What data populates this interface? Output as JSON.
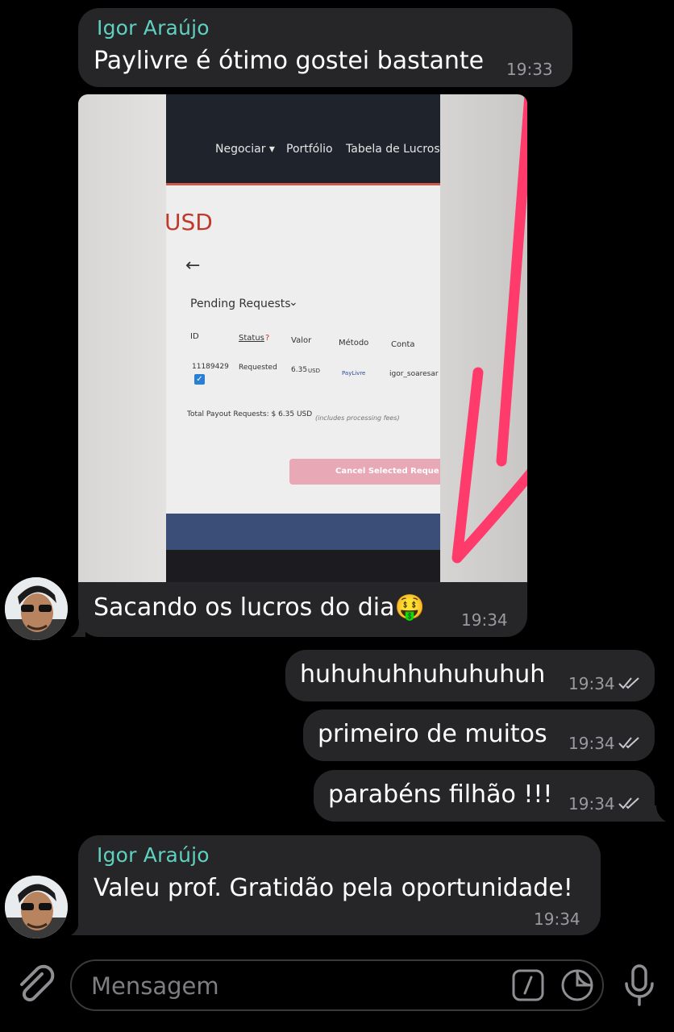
{
  "messages": [
    {
      "sender": "Igor Araújo",
      "text": "Paylivre é ótimo gostei bastante",
      "time": "19:33"
    },
    {
      "text": "Sacando os lucros do dia🤑",
      "time": "19:34",
      "screenshot": {
        "nav": [
          "Negociar ▾",
          "Portfólio",
          "Tabela de Lucros"
        ],
        "currency": "USD",
        "filter": "Pending Requests",
        "columns": [
          "ID",
          "Status",
          "?",
          "Valor",
          "Método",
          "Conta"
        ],
        "row": {
          "id": "11189429",
          "status": "Requested",
          "valor": "6.35",
          "valor_unit": "USD",
          "metodo": "PayLivre",
          "conta": "igor_soaresar"
        },
        "total": "Total Payout Requests: $ 6.35 USD",
        "total_note": "(includes processing fees)",
        "button": "Cancel Selected Reque"
      }
    },
    {
      "text": "huhuhuhhuhuhuhuh",
      "time": "19:34"
    },
    {
      "text": "primeiro de muitos",
      "time": "19:34"
    },
    {
      "text": "parabéns filhão !!!",
      "time": "19:34"
    },
    {
      "sender": "Igor Araújo",
      "text": "Valeu prof. Gratidão pela oportunidade!",
      "time": "19:34"
    }
  ],
  "composer": {
    "placeholder": "Mensagem"
  },
  "colors": {
    "sender": "#5ed1c0",
    "bubble": "#262628",
    "annotation_arrow": "#ff3b6b"
  },
  "icons": [
    "attach-icon",
    "slash-command-icon",
    "sticker-icon",
    "microphone-icon",
    "double-check-icon"
  ]
}
